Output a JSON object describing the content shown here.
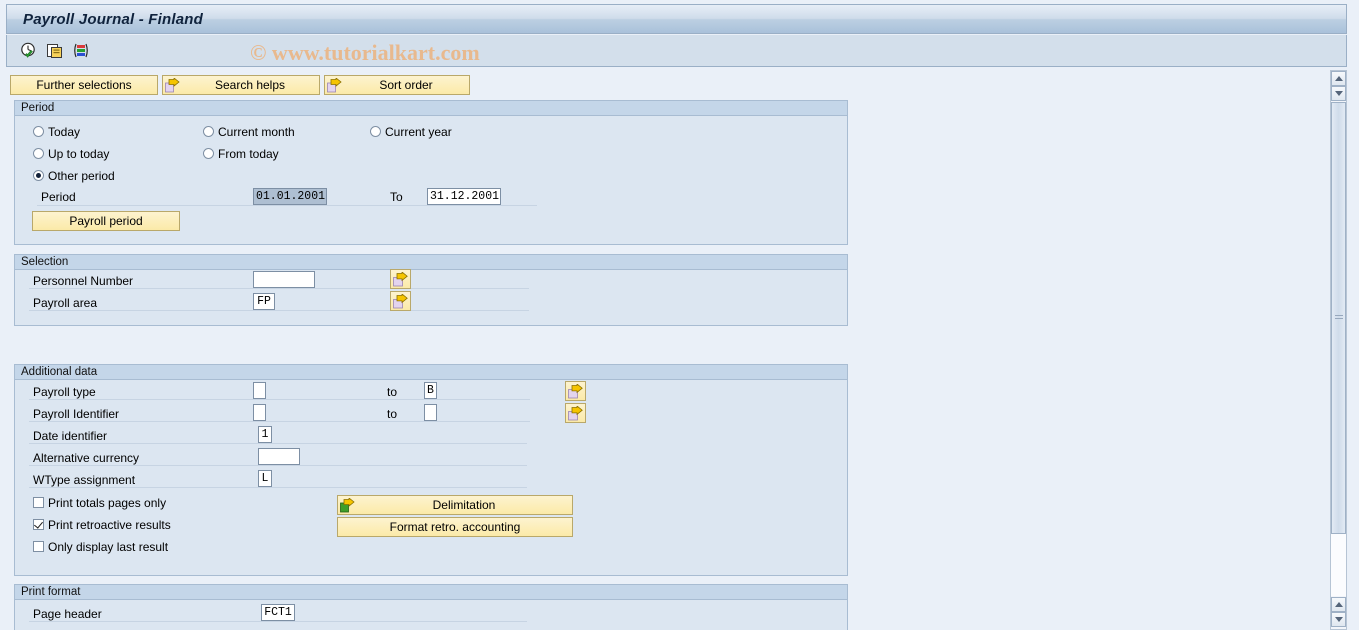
{
  "window": {
    "title": "Payroll Journal - Finland"
  },
  "watermark": "© www.tutorialkart.com",
  "toolbar": {
    "icons": [
      {
        "name": "execute-clock-icon",
        "title": "Execute"
      },
      {
        "name": "copy-variant-icon",
        "title": "Get Variant"
      },
      {
        "name": "color-legend-icon",
        "title": "Variant"
      }
    ]
  },
  "action_buttons": [
    {
      "label": "Further selections",
      "icon": false
    },
    {
      "label": "Search helps",
      "icon": true
    },
    {
      "label": "Sort order",
      "icon": true
    }
  ],
  "period": {
    "group_label": "Period",
    "options": [
      {
        "label": "Today",
        "selected": false
      },
      {
        "label": "Current month",
        "selected": false
      },
      {
        "label": "Current year",
        "selected": false
      },
      {
        "label": "Up to today",
        "selected": false
      },
      {
        "label": "From today",
        "selected": false
      },
      {
        "label": "Other period",
        "selected": true
      }
    ],
    "period_label": "Period",
    "period_from_value": "01.01.2001",
    "to_label": "To",
    "period_to_value": "31.12.2001",
    "payroll_period_button": "Payroll period"
  },
  "selection": {
    "group_label": "Selection",
    "rows": [
      {
        "label": "Personnel Number",
        "value": ""
      },
      {
        "label": "Payroll area",
        "value": "FP"
      }
    ],
    "multi_select_tooltip": "Multiple selection"
  },
  "additional_data": {
    "group_label": "Additional data",
    "rows": [
      {
        "label": "Payroll type",
        "value": "",
        "to_label": "to",
        "to_value": "B"
      },
      {
        "label": "Payroll Identifier",
        "value": "",
        "to_label": "to",
        "to_value": ""
      },
      {
        "label": "Date identifier",
        "value": "1"
      },
      {
        "label": "Alternative currency",
        "value": ""
      },
      {
        "label": "WType assignment",
        "value": "L"
      }
    ],
    "checkboxes": [
      {
        "label": "Print totals pages only",
        "checked": false
      },
      {
        "label": "Print retroactive results",
        "checked": true
      },
      {
        "label": "Only display last result",
        "checked": false
      }
    ],
    "buttons": [
      {
        "label": "Delimitation",
        "icon": true
      },
      {
        "label": "Format retro. accounting",
        "icon": false
      }
    ]
  },
  "print_format": {
    "group_label": "Print format",
    "rows": [
      {
        "label": "Page header",
        "value": "FCT1"
      }
    ]
  },
  "colors": {
    "accent_button": "#fbeaa8",
    "group_header": "#c4d6e9",
    "group_body": "#dce6f1",
    "page_background": "#eaf0f8",
    "title_bar": "#bccfe2",
    "watermark": "#e8b98e",
    "selected_field": "#aebfd2"
  }
}
